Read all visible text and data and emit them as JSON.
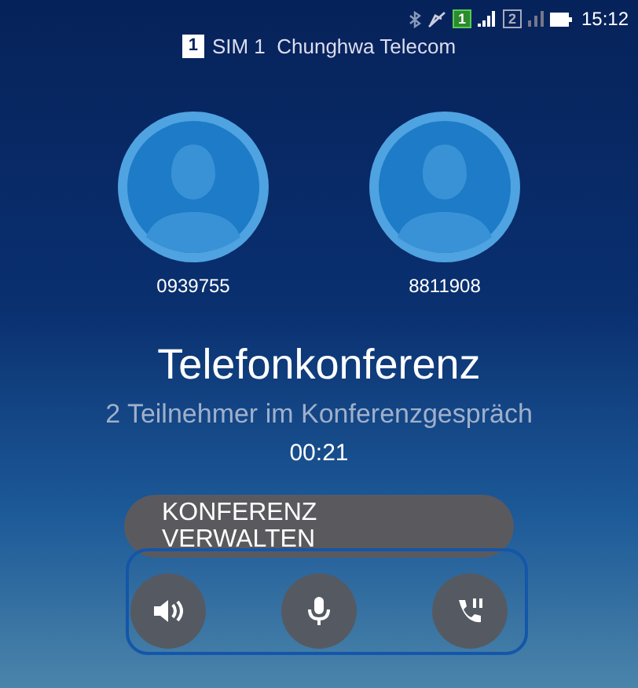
{
  "status_bar": {
    "sim1_badge": "1",
    "sim2_badge": "2",
    "time": "15:12"
  },
  "carrier": {
    "sim_badge": "1",
    "label": "SIM 1  Chunghwa Telecom"
  },
  "participants": [
    {
      "number": "0939755"
    },
    {
      "number": "8811908"
    }
  ],
  "title": "Telefonkonferenz",
  "subtitle": "2 Teilnehmer im Konferenzgespräch",
  "timer": "00:21",
  "manage_button": "KONFERENZ VERWALTEN",
  "controls": [
    {
      "kind": "speaker"
    },
    {
      "kind": "mute"
    },
    {
      "kind": "hold"
    }
  ]
}
